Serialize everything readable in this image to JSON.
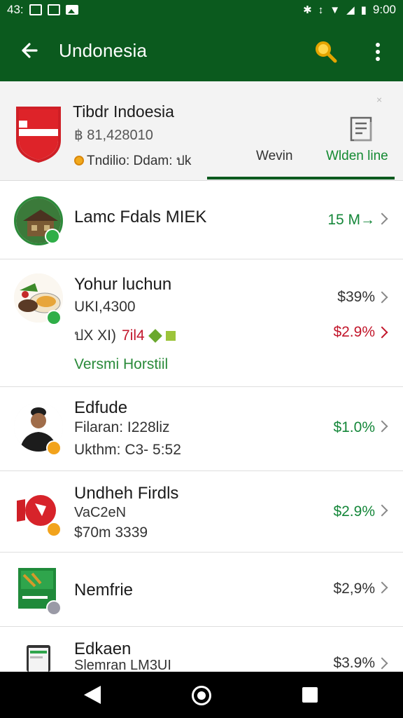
{
  "status_bar": {
    "time_left": "43:",
    "time_right": "9:00"
  },
  "app_bar": {
    "title": "Undonesia"
  },
  "header": {
    "title": "Tibdr Indoesia",
    "subtitle": "฿ 81,428010",
    "detail": "Tndilio: Ddam: ปk",
    "tab_1": "Wevin",
    "tab_2": "Wlden line",
    "close": "×"
  },
  "rows": [
    {
      "title": "Lamc Fdals MIEK",
      "value": "15 M→"
    },
    {
      "title": "Yohur luchun",
      "line1": "UKI,4300",
      "line2_a": "ปX XI)",
      "line2_b": "7il4",
      "line3": "Versmi Horstiil",
      "value_1": "$39%",
      "value_2": "$2.9%"
    },
    {
      "title": "Edfude",
      "line1": "Filaran: I228liz",
      "line2": "Ukthm: C3- 5:52",
      "value": "$1.0%"
    },
    {
      "title": "Undheh Firdls",
      "line1": "VaC2eN",
      "line2": "$70m 3339",
      "value": "$2.9%"
    },
    {
      "title": "Nemfrie",
      "value": "$2,9%"
    },
    {
      "title": "Edkaen",
      "line1": "Slemran LM3UI",
      "value": "$3.9%"
    }
  ],
  "colors": {
    "primary": "#0b5a1e",
    "green_text": "#15873a",
    "red_text": "#c2162b"
  },
  "icons": [
    "arrow-left-icon",
    "search-icon",
    "more-vert-icon",
    "document-icon",
    "chevron-right-icon"
  ]
}
